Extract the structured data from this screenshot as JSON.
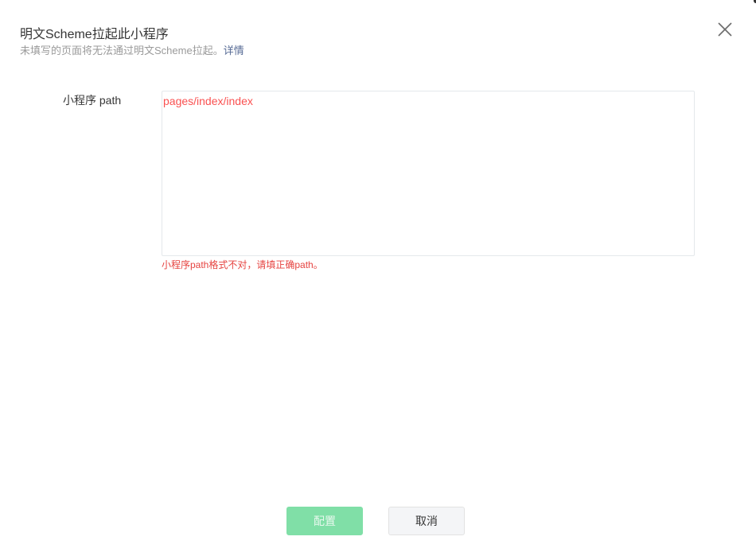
{
  "dialog": {
    "title": "明文Scheme拉起此小程序",
    "subtitle": "未填写的页面将无法通过明文Scheme拉起。",
    "detail_link": "详情",
    "close_icon": "close-icon"
  },
  "form": {
    "path_label": "小程序 path",
    "path_value": "pages/index/index",
    "error_text": "小程序path格式不对，请填正确path。"
  },
  "footer": {
    "confirm_label": "配置",
    "cancel_label": "取消"
  },
  "colors": {
    "primary_disabled": "#80dfa7",
    "error": "#e64340",
    "link": "#576b95"
  }
}
